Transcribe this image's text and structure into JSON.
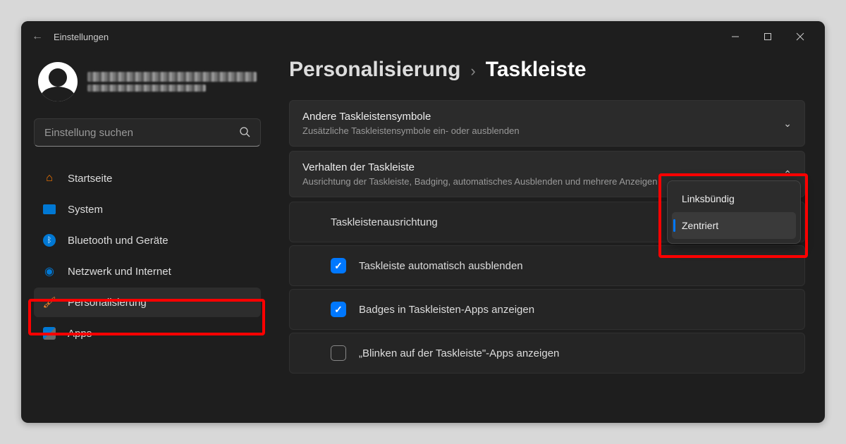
{
  "titlebar": {
    "app_name": "Einstellungen"
  },
  "search": {
    "placeholder": "Einstellung suchen"
  },
  "sidebar": {
    "items": [
      {
        "label": "Startseite",
        "icon": "home"
      },
      {
        "label": "System",
        "icon": "system"
      },
      {
        "label": "Bluetooth und Geräte",
        "icon": "bluetooth"
      },
      {
        "label": "Netzwerk und Internet",
        "icon": "network"
      },
      {
        "label": "Personalisierung",
        "icon": "personalization",
        "active": true
      },
      {
        "label": "Apps",
        "icon": "apps"
      }
    ]
  },
  "breadcrumb": {
    "parent": "Personalisierung",
    "current": "Taskleiste"
  },
  "sections": {
    "other_icons": {
      "title": "Andere Taskleistensymbole",
      "subtitle": "Zusätzliche Taskleistensymbole ein- oder ausblenden",
      "expanded": false
    },
    "behavior": {
      "title": "Verhalten der Taskleiste",
      "subtitle": "Ausrichtung der Taskleiste, Badging, automatisches Ausblenden und mehrere Anzeigen",
      "expanded": true
    }
  },
  "alignment_row": {
    "label": "Taskleistenausrichtung"
  },
  "alignment_options": [
    {
      "label": "Linksbündig",
      "selected": false
    },
    {
      "label": "Zentriert",
      "selected": true
    }
  ],
  "checkboxes": [
    {
      "label": "Taskleiste automatisch ausblenden",
      "checked": true
    },
    {
      "label": "Badges in Taskleisten-Apps anzeigen",
      "checked": true
    },
    {
      "label": "„Blinken auf der Taskleiste\"-Apps anzeigen",
      "checked": false
    }
  ]
}
